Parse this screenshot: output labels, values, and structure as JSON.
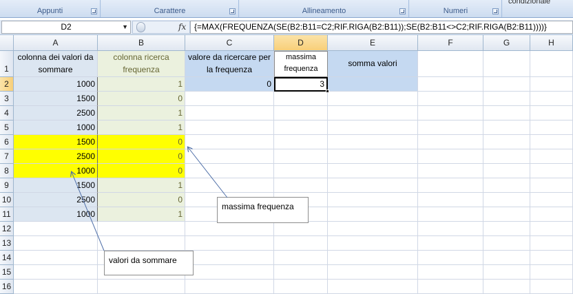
{
  "ribbon": {
    "top_partial": "condizionale",
    "groups": [
      {
        "label": "Appunti"
      },
      {
        "label": "Carattere"
      },
      {
        "label": "Allineamento"
      },
      {
        "label": "Numeri"
      }
    ]
  },
  "formula_bar": {
    "name_box": "D2",
    "fx_icon": "fx",
    "formula": "{=MAX(FREQUENZA(SE(B2:B11=C2;RIF.RIGA(B2:B11));SE(B2:B11<>C2;RIF.RIGA(B2:B11))))}"
  },
  "sheet": {
    "columns": [
      "A",
      "B",
      "C",
      "D",
      "E",
      "F",
      "G",
      "H"
    ],
    "selected_column": "D",
    "selected_row": "2",
    "rows": [
      "1",
      "2",
      "3",
      "4",
      "5",
      "6",
      "7",
      "8",
      "9",
      "10",
      "11",
      "12",
      "13",
      "14",
      "15",
      "16"
    ],
    "headers": {
      "A": "colonna dei valori da sommare",
      "B": "colonna ricerca frequenza",
      "C": "valore da ricercare per la frequenza",
      "D": "massima frequenza",
      "E": "somma valori"
    },
    "row2_values": {
      "C": "0",
      "D": "3",
      "E": ""
    },
    "col_a": [
      "1000",
      "1500",
      "2500",
      "1000",
      "1500",
      "2500",
      "1000",
      "1500",
      "2500",
      "1000"
    ],
    "col_b": [
      "1",
      "0",
      "1",
      "1",
      "0",
      "0",
      "0",
      "1",
      "0",
      "1"
    ],
    "highlight_rows": [
      6,
      7,
      8
    ]
  },
  "callouts": {
    "massima": "massima frequenza",
    "valori": "valori da sommare"
  },
  "colors": {
    "header_blue": "#c5d9f1",
    "header_green": "#ebf1de",
    "col_a_fill": "#dce6f1",
    "col_b_fill": "#ebf1de",
    "highlight_yellow": "#ffff00",
    "selection": "#f8cf79"
  }
}
